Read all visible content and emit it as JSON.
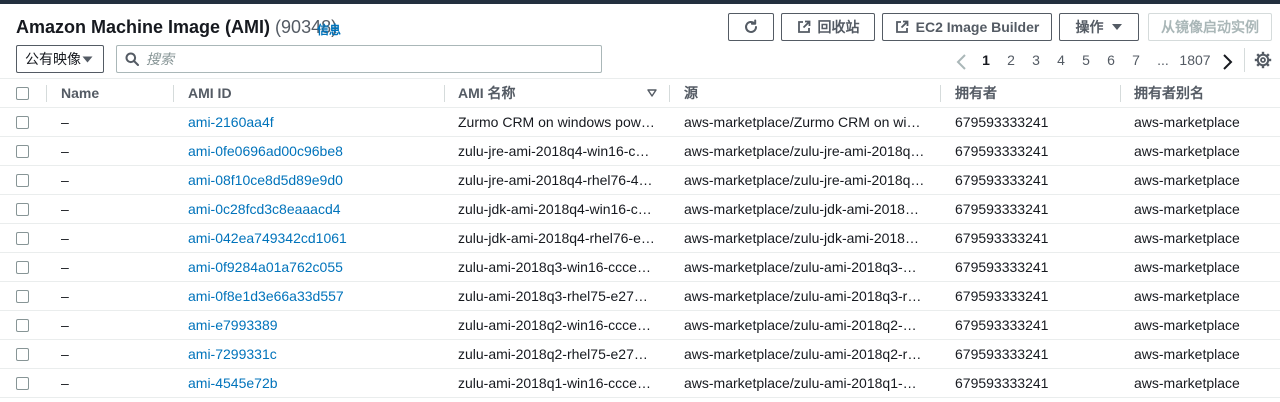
{
  "header": {
    "title": "Amazon Machine Image (AMI)",
    "count": "(90348)",
    "info_link": "信息"
  },
  "toolbar": {
    "recycle_bin_label": "回收站",
    "image_builder_label": "EC2 Image Builder",
    "actions_label": "操作",
    "launch_label": "从镜像启动实例"
  },
  "filter": {
    "selected": "公有映像",
    "search_placeholder": "搜索"
  },
  "pagination": {
    "current": "1",
    "pages": [
      "2",
      "3",
      "4",
      "5",
      "6",
      "7"
    ],
    "ellipsis": "...",
    "last": "1807"
  },
  "table": {
    "columns": [
      "Name",
      "AMI ID",
      "AMI 名称",
      "源",
      "拥有者",
      "拥有者别名"
    ],
    "rows": [
      {
        "name": "–",
        "ami_id": "ami-2160aa4f",
        "ami_name": "Zurmo CRM on windows power…",
        "source": "aws-marketplace/Zurmo CRM on windo…",
        "owner": "679593333241",
        "alias": "aws-marketplace"
      },
      {
        "name": "–",
        "ami_id": "ami-0fe0696ad00c96be8",
        "ami_name": "zulu-jre-ami-2018q4-win16-c5c…",
        "source": "aws-marketplace/zulu-jre-ami-2018q4-…",
        "owner": "679593333241",
        "alias": "aws-marketplace"
      },
      {
        "name": "–",
        "ami_id": "ami-08f10ce8d5d89e9d0",
        "ami_name": "zulu-jre-ami-2018q4-rhel76-41…",
        "source": "aws-marketplace/zulu-jre-ami-2018q4-…",
        "owner": "679593333241",
        "alias": "aws-marketplace"
      },
      {
        "name": "–",
        "ami_id": "ami-0c28fcd3c8eaaacd4",
        "ami_name": "zulu-jdk-ami-2018q4-win16-ccc…",
        "source": "aws-marketplace/zulu-jdk-ami-2018q4…",
        "owner": "679593333241",
        "alias": "aws-marketplace"
      },
      {
        "name": "–",
        "ami_id": "ami-042ea749342cd1061",
        "ami_name": "zulu-jdk-ami-2018q4-rhel76-e2…",
        "source": "aws-marketplace/zulu-jdk-ami-2018q4…",
        "owner": "679593333241",
        "alias": "aws-marketplace"
      },
      {
        "name": "–",
        "ami_id": "ami-0f9284a01a762c055",
        "ami_name": "zulu-ami-2018q3-win16-cccec6…",
        "source": "aws-marketplace/zulu-ami-2018q3-win…",
        "owner": "679593333241",
        "alias": "aws-marketplace"
      },
      {
        "name": "–",
        "ami_id": "ami-0f8e1d3e66a33d557",
        "ami_name": "zulu-ami-2018q3-rhel75-e276c…",
        "source": "aws-marketplace/zulu-ami-2018q3-rhe…",
        "owner": "679593333241",
        "alias": "aws-marketplace"
      },
      {
        "name": "–",
        "ami_id": "ami-e7993389",
        "ami_name": "zulu-ami-2018q2-win16-cccec6…",
        "source": "aws-marketplace/zulu-ami-2018q2-win…",
        "owner": "679593333241",
        "alias": "aws-marketplace"
      },
      {
        "name": "–",
        "ami_id": "ami-7299331c",
        "ami_name": "zulu-ami-2018q2-rhel75-e276c…",
        "source": "aws-marketplace/zulu-ami-2018q2-rhe…",
        "owner": "679593333241",
        "alias": "aws-marketplace"
      },
      {
        "name": "–",
        "ami_id": "ami-4545e72b",
        "ami_name": "zulu-ami-2018q1-win16-cccec6…",
        "source": "aws-marketplace/zulu-ami-2018q1-win…",
        "owner": "679593333241",
        "alias": "aws-marketplace"
      }
    ]
  },
  "colors": {
    "link": "#0073bb",
    "text": "#16191f",
    "secondary": "#545b64",
    "border": "#eaeded",
    "topbar": "#232f3e"
  }
}
